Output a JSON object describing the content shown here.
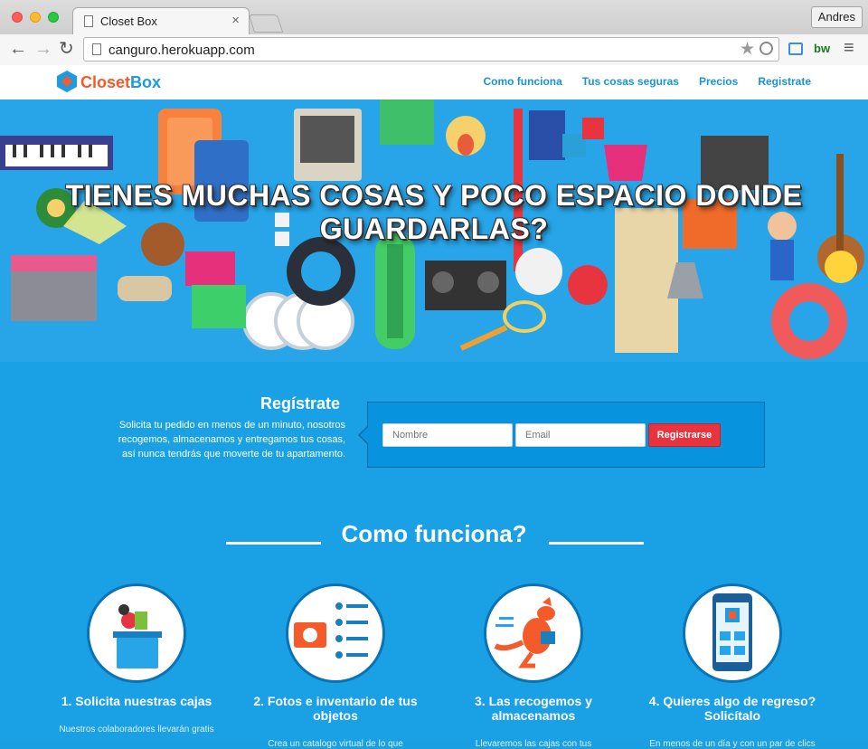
{
  "browser": {
    "tab_title": "Closet Box",
    "tab_close": "×",
    "url": "canguro.herokuapp.com",
    "user": "Andres",
    "back_icon": "←",
    "forward_icon": "→",
    "reload_icon": "↻",
    "star_icon": "★",
    "menu_icon": "≡",
    "ext_label": "bw"
  },
  "header": {
    "logo_part1": "Closet",
    "logo_part2": "Box",
    "nav": [
      "Como funciona",
      "Tus cosas seguras",
      "Precios",
      "Registrate"
    ]
  },
  "hero": {
    "title": "TIENES MUCHAS COSAS Y POCO ESPACIO DONDE GUARDARLAS?"
  },
  "signup": {
    "title": "Regístrate",
    "text": "Solicita tu pedido en menos de un minuto, nosotros recogemos, almacenamos y entregamos tus cosas, así nunca tendrás que moverte de tu apartamento.",
    "name_placeholder": "Nombre",
    "email_placeholder": "Email",
    "button": "Registrarse"
  },
  "how": {
    "title": "Como funciona?",
    "steps": [
      {
        "title": "1. Solicita nuestras cajas",
        "desc": "Nuestros colaboradores llevarán gratis",
        "icon": "bin-icon"
      },
      {
        "title": "2. Fotos e inventario de tus objetos",
        "desc": "Crea un catalogo virtual de lo que",
        "icon": "camera-list-icon"
      },
      {
        "title": "3. Las recogemos y almacenamos",
        "desc": "Llevaremos las cajas con tus",
        "icon": "kangaroo-icon"
      },
      {
        "title": "4. Quieres algo de regreso? Solicítalo",
        "desc": "En menos de un día y con un par de clics",
        "icon": "phone-boxes-icon"
      }
    ]
  },
  "colors": {
    "brand_blue": "#1aa0e4",
    "brand_orange": "#f45a2a",
    "button_red": "#e8343f"
  }
}
